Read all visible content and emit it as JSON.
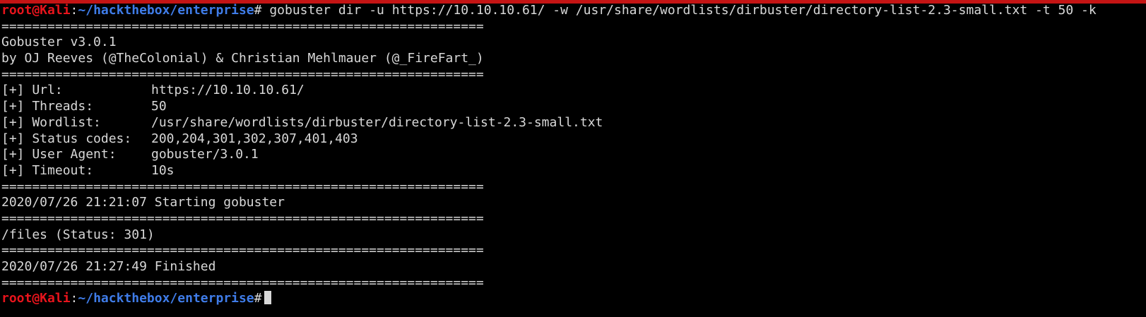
{
  "colors": {
    "background": "#000000",
    "text": "#d8d8d8",
    "prompt_user": "#e8141c",
    "prompt_path": "#3f7ce8",
    "top_bar": "#c41414"
  },
  "prompt": {
    "user_host": "root@Kali",
    "colon": ":",
    "path": "~/hackthebox/enterprise",
    "symbol": "#"
  },
  "command": " gobuster dir -u https://10.10.10.61/ -w /usr/share/wordlists/dirbuster/directory-list-2.3-small.txt -t 50 -k",
  "output": {
    "separator": "===============================================================",
    "banner": [
      "Gobuster v3.0.1",
      "by OJ Reeves (@TheColonial) & Christian Mehlmauer (@_FireFart_)"
    ],
    "config": [
      {
        "label": "[+] Url:",
        "value": "https://10.10.10.61/"
      },
      {
        "label": "[+] Threads:",
        "value": "50"
      },
      {
        "label": "[+] Wordlist:",
        "value": "/usr/share/wordlists/dirbuster/directory-list-2.3-small.txt"
      },
      {
        "label": "[+] Status codes:",
        "value": "200,204,301,302,307,401,403"
      },
      {
        "label": "[+] User Agent:",
        "value": "gobuster/3.0.1"
      },
      {
        "label": "[+] Timeout:",
        "value": "10s"
      }
    ],
    "start_line": "2020/07/26 21:21:07 Starting gobuster",
    "result_line": "/files (Status: 301)",
    "finish_line": "2020/07/26 21:27:49 Finished"
  }
}
